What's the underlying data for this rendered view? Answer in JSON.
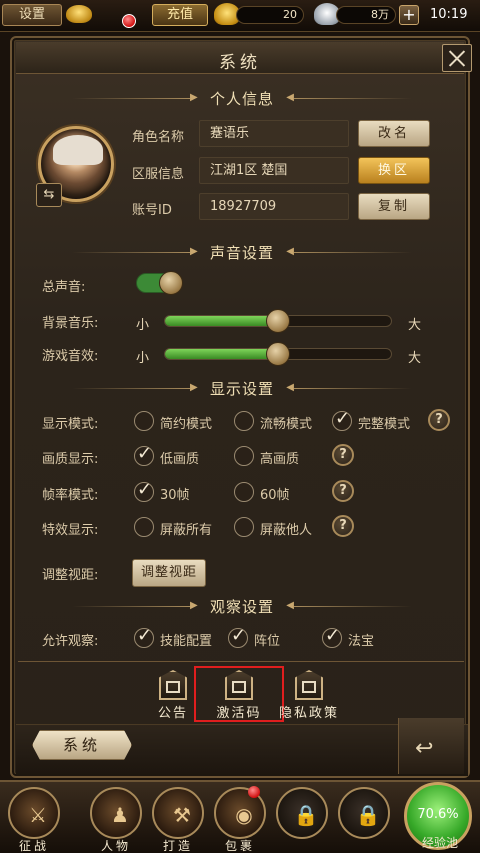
{
  "topbar": {
    "settings_label": "设置",
    "recharge_label": "充值",
    "gold_amount": "20",
    "silver_amount": "8万",
    "plus_label": "+",
    "clock": "10:19"
  },
  "panel": {
    "title": "系统",
    "profile": {
      "section_title": "个人信息",
      "rows": [
        {
          "label": "角色名称",
          "value": "蹇语乐",
          "button": "改名"
        },
        {
          "label": "区服信息",
          "value": "江湖1区 楚国",
          "button": "换区"
        },
        {
          "label": "账号ID",
          "value": "18927709",
          "button": "复制"
        }
      ]
    },
    "sound": {
      "section_title": "声音设置",
      "master_label": "总声音:",
      "master_on": true,
      "music_label": "背景音乐:",
      "effects_label": "游戏音效:",
      "min_label": "小",
      "max_label": "大",
      "music_level": 0.5,
      "effects_level": 0.5
    },
    "display": {
      "section_title": "显示设置",
      "mode_label": "显示模式:",
      "mode_options": [
        "简约模式",
        "流畅模式",
        "完整模式"
      ],
      "quality_label": "画质显示:",
      "quality_options": [
        "低画质",
        "高画质"
      ],
      "fps_label": "帧率模式:",
      "fps_options": [
        "30帧",
        "60帧"
      ],
      "effects_label": "特效显示:",
      "effects_options": [
        "屏蔽所有",
        "屏蔽他人"
      ],
      "view_label": "调整视距:",
      "view_button": "调整视距",
      "help": "?"
    },
    "observe": {
      "section_title": "观察设置",
      "allow_label": "允许观察:",
      "options": [
        "技能配置",
        "阵位",
        "法宝"
      ]
    },
    "footer_tabs": [
      "公告",
      "激活码",
      "隐私政策"
    ],
    "current_tab": "系统"
  },
  "bottom_nav": {
    "items": [
      "征战",
      "人物",
      "打造",
      "包裹",
      "",
      ""
    ],
    "exp_percent": "70.6%",
    "exp_label": "经验池"
  }
}
